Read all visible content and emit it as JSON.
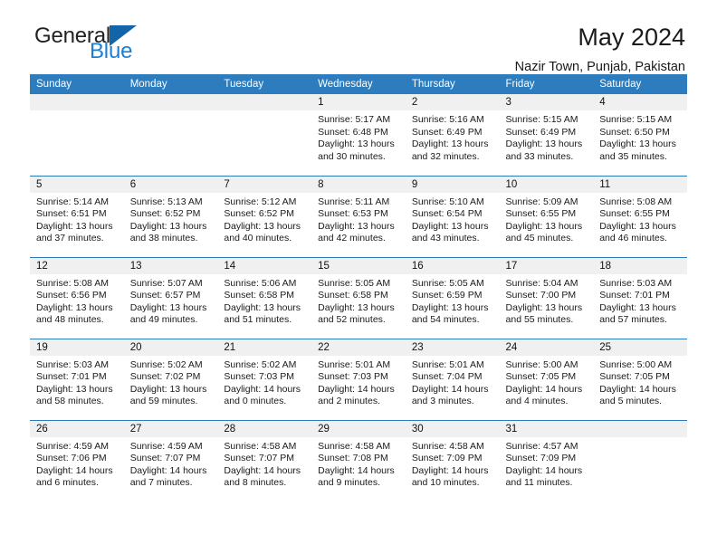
{
  "brand": {
    "name_part1": "General",
    "name_part2": "Blue",
    "logo_icon": "triangle-flag-icon"
  },
  "header": {
    "title": "May 2024",
    "subtitle": "Nazir Town, Punjab, Pakistan"
  },
  "calendar": {
    "weekday_headers": [
      "Sunday",
      "Monday",
      "Tuesday",
      "Wednesday",
      "Thursday",
      "Friday",
      "Saturday"
    ],
    "header_bg": "#2c7cbe",
    "daynum_bg": "#f0f0f0",
    "weeks": [
      [
        {
          "day": "",
          "sunrise": "",
          "sunset": "",
          "daylight_line1": "",
          "daylight_line2": ""
        },
        {
          "day": "",
          "sunrise": "",
          "sunset": "",
          "daylight_line1": "",
          "daylight_line2": ""
        },
        {
          "day": "",
          "sunrise": "",
          "sunset": "",
          "daylight_line1": "",
          "daylight_line2": ""
        },
        {
          "day": "1",
          "sunrise": "Sunrise: 5:17 AM",
          "sunset": "Sunset: 6:48 PM",
          "daylight_line1": "Daylight: 13 hours",
          "daylight_line2": "and 30 minutes."
        },
        {
          "day": "2",
          "sunrise": "Sunrise: 5:16 AM",
          "sunset": "Sunset: 6:49 PM",
          "daylight_line1": "Daylight: 13 hours",
          "daylight_line2": "and 32 minutes."
        },
        {
          "day": "3",
          "sunrise": "Sunrise: 5:15 AM",
          "sunset": "Sunset: 6:49 PM",
          "daylight_line1": "Daylight: 13 hours",
          "daylight_line2": "and 33 minutes."
        },
        {
          "day": "4",
          "sunrise": "Sunrise: 5:15 AM",
          "sunset": "Sunset: 6:50 PM",
          "daylight_line1": "Daylight: 13 hours",
          "daylight_line2": "and 35 minutes."
        }
      ],
      [
        {
          "day": "5",
          "sunrise": "Sunrise: 5:14 AM",
          "sunset": "Sunset: 6:51 PM",
          "daylight_line1": "Daylight: 13 hours",
          "daylight_line2": "and 37 minutes."
        },
        {
          "day": "6",
          "sunrise": "Sunrise: 5:13 AM",
          "sunset": "Sunset: 6:52 PM",
          "daylight_line1": "Daylight: 13 hours",
          "daylight_line2": "and 38 minutes."
        },
        {
          "day": "7",
          "sunrise": "Sunrise: 5:12 AM",
          "sunset": "Sunset: 6:52 PM",
          "daylight_line1": "Daylight: 13 hours",
          "daylight_line2": "and 40 minutes."
        },
        {
          "day": "8",
          "sunrise": "Sunrise: 5:11 AM",
          "sunset": "Sunset: 6:53 PM",
          "daylight_line1": "Daylight: 13 hours",
          "daylight_line2": "and 42 minutes."
        },
        {
          "day": "9",
          "sunrise": "Sunrise: 5:10 AM",
          "sunset": "Sunset: 6:54 PM",
          "daylight_line1": "Daylight: 13 hours",
          "daylight_line2": "and 43 minutes."
        },
        {
          "day": "10",
          "sunrise": "Sunrise: 5:09 AM",
          "sunset": "Sunset: 6:55 PM",
          "daylight_line1": "Daylight: 13 hours",
          "daylight_line2": "and 45 minutes."
        },
        {
          "day": "11",
          "sunrise": "Sunrise: 5:08 AM",
          "sunset": "Sunset: 6:55 PM",
          "daylight_line1": "Daylight: 13 hours",
          "daylight_line2": "and 46 minutes."
        }
      ],
      [
        {
          "day": "12",
          "sunrise": "Sunrise: 5:08 AM",
          "sunset": "Sunset: 6:56 PM",
          "daylight_line1": "Daylight: 13 hours",
          "daylight_line2": "and 48 minutes."
        },
        {
          "day": "13",
          "sunrise": "Sunrise: 5:07 AM",
          "sunset": "Sunset: 6:57 PM",
          "daylight_line1": "Daylight: 13 hours",
          "daylight_line2": "and 49 minutes."
        },
        {
          "day": "14",
          "sunrise": "Sunrise: 5:06 AM",
          "sunset": "Sunset: 6:58 PM",
          "daylight_line1": "Daylight: 13 hours",
          "daylight_line2": "and 51 minutes."
        },
        {
          "day": "15",
          "sunrise": "Sunrise: 5:05 AM",
          "sunset": "Sunset: 6:58 PM",
          "daylight_line1": "Daylight: 13 hours",
          "daylight_line2": "and 52 minutes."
        },
        {
          "day": "16",
          "sunrise": "Sunrise: 5:05 AM",
          "sunset": "Sunset: 6:59 PM",
          "daylight_line1": "Daylight: 13 hours",
          "daylight_line2": "and 54 minutes."
        },
        {
          "day": "17",
          "sunrise": "Sunrise: 5:04 AM",
          "sunset": "Sunset: 7:00 PM",
          "daylight_line1": "Daylight: 13 hours",
          "daylight_line2": "and 55 minutes."
        },
        {
          "day": "18",
          "sunrise": "Sunrise: 5:03 AM",
          "sunset": "Sunset: 7:01 PM",
          "daylight_line1": "Daylight: 13 hours",
          "daylight_line2": "and 57 minutes."
        }
      ],
      [
        {
          "day": "19",
          "sunrise": "Sunrise: 5:03 AM",
          "sunset": "Sunset: 7:01 PM",
          "daylight_line1": "Daylight: 13 hours",
          "daylight_line2": "and 58 minutes."
        },
        {
          "day": "20",
          "sunrise": "Sunrise: 5:02 AM",
          "sunset": "Sunset: 7:02 PM",
          "daylight_line1": "Daylight: 13 hours",
          "daylight_line2": "and 59 minutes."
        },
        {
          "day": "21",
          "sunrise": "Sunrise: 5:02 AM",
          "sunset": "Sunset: 7:03 PM",
          "daylight_line1": "Daylight: 14 hours",
          "daylight_line2": "and 0 minutes."
        },
        {
          "day": "22",
          "sunrise": "Sunrise: 5:01 AM",
          "sunset": "Sunset: 7:03 PM",
          "daylight_line1": "Daylight: 14 hours",
          "daylight_line2": "and 2 minutes."
        },
        {
          "day": "23",
          "sunrise": "Sunrise: 5:01 AM",
          "sunset": "Sunset: 7:04 PM",
          "daylight_line1": "Daylight: 14 hours",
          "daylight_line2": "and 3 minutes."
        },
        {
          "day": "24",
          "sunrise": "Sunrise: 5:00 AM",
          "sunset": "Sunset: 7:05 PM",
          "daylight_line1": "Daylight: 14 hours",
          "daylight_line2": "and 4 minutes."
        },
        {
          "day": "25",
          "sunrise": "Sunrise: 5:00 AM",
          "sunset": "Sunset: 7:05 PM",
          "daylight_line1": "Daylight: 14 hours",
          "daylight_line2": "and 5 minutes."
        }
      ],
      [
        {
          "day": "26",
          "sunrise": "Sunrise: 4:59 AM",
          "sunset": "Sunset: 7:06 PM",
          "daylight_line1": "Daylight: 14 hours",
          "daylight_line2": "and 6 minutes."
        },
        {
          "day": "27",
          "sunrise": "Sunrise: 4:59 AM",
          "sunset": "Sunset: 7:07 PM",
          "daylight_line1": "Daylight: 14 hours",
          "daylight_line2": "and 7 minutes."
        },
        {
          "day": "28",
          "sunrise": "Sunrise: 4:58 AM",
          "sunset": "Sunset: 7:07 PM",
          "daylight_line1": "Daylight: 14 hours",
          "daylight_line2": "and 8 minutes."
        },
        {
          "day": "29",
          "sunrise": "Sunrise: 4:58 AM",
          "sunset": "Sunset: 7:08 PM",
          "daylight_line1": "Daylight: 14 hours",
          "daylight_line2": "and 9 minutes."
        },
        {
          "day": "30",
          "sunrise": "Sunrise: 4:58 AM",
          "sunset": "Sunset: 7:09 PM",
          "daylight_line1": "Daylight: 14 hours",
          "daylight_line2": "and 10 minutes."
        },
        {
          "day": "31",
          "sunrise": "Sunrise: 4:57 AM",
          "sunset": "Sunset: 7:09 PM",
          "daylight_line1": "Daylight: 14 hours",
          "daylight_line2": "and 11 minutes."
        },
        {
          "day": "",
          "sunrise": "",
          "sunset": "",
          "daylight_line1": "",
          "daylight_line2": ""
        }
      ]
    ]
  }
}
